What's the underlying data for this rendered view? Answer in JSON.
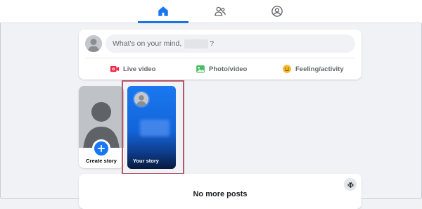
{
  "nav": {
    "tabs": [
      {
        "name": "home",
        "icon": "home-icon",
        "active": true
      },
      {
        "name": "friends",
        "icon": "friends-icon",
        "active": false
      },
      {
        "name": "profile",
        "icon": "profile-icon",
        "active": false
      }
    ]
  },
  "composer": {
    "placeholder_prefix": "What's on your mind,",
    "placeholder_suffix": "?",
    "actions": [
      {
        "label": "Live video",
        "icon": "live-video-icon",
        "color": "#f02849"
      },
      {
        "label": "Photo/video",
        "icon": "photo-icon",
        "color": "#45bd62"
      },
      {
        "label": "Feeling/activity",
        "icon": "feeling-icon",
        "color": "#f7b928"
      }
    ]
  },
  "stories": {
    "create_label": "Create story",
    "your_story_label": "Your story"
  },
  "feed": {
    "no_more_posts": "No more posts"
  },
  "colors": {
    "accent": "#1877f2",
    "highlight": "#b5566b"
  }
}
